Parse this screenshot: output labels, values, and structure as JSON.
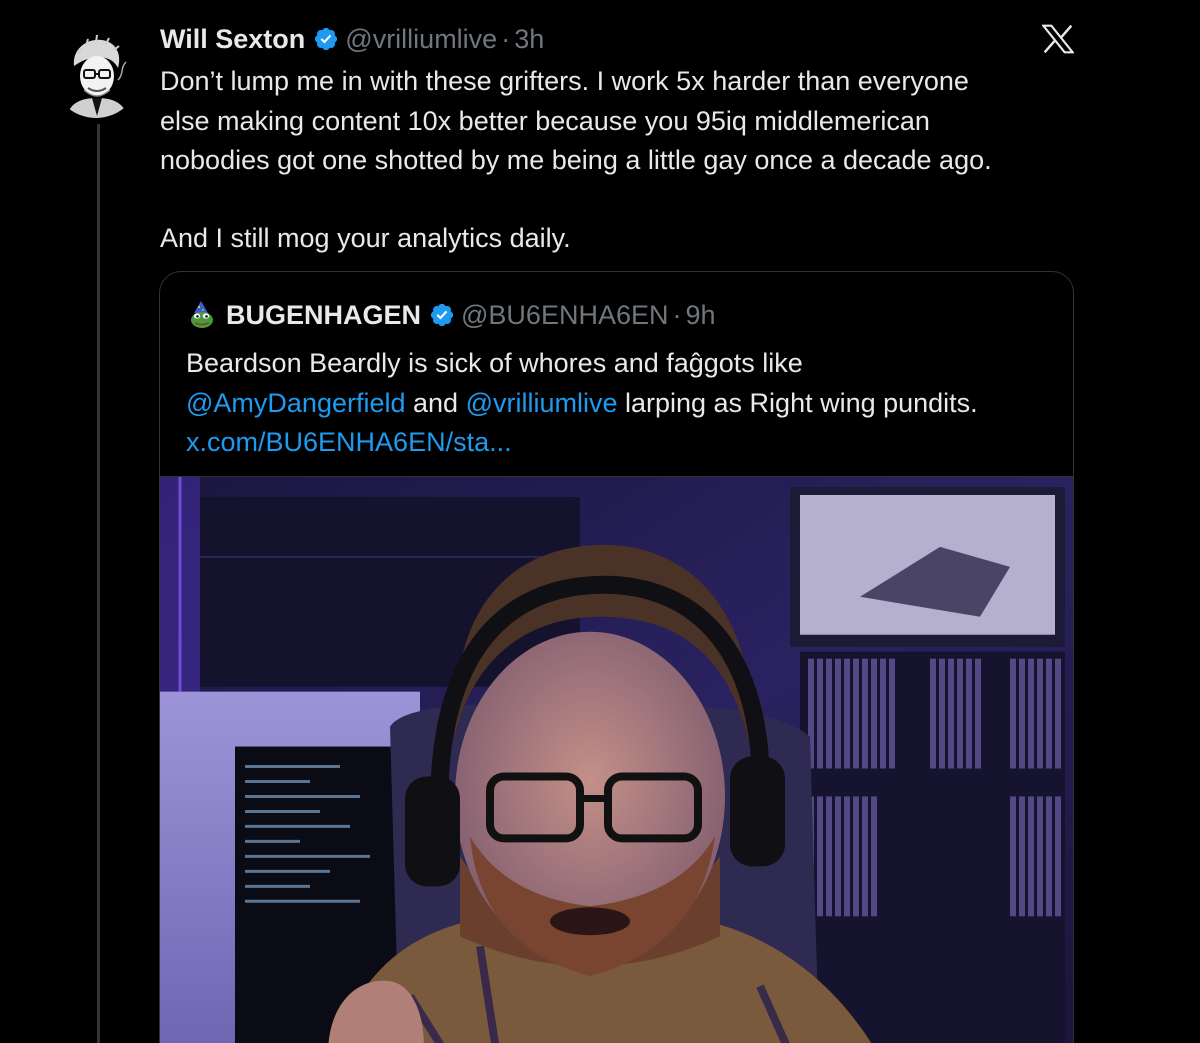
{
  "tweet": {
    "display_name": "Will Sexton",
    "handle": "@vrilliumlive",
    "separator": "·",
    "time": "3h",
    "body_lines": [
      "Don’t lump me in with these grifters. I work 5x harder than everyone",
      "else making content 10x better because you 95iq middlemerican",
      "nobodies got one shotted by me being a little gay once a decade ago."
    ],
    "body_last": "And I still mog your analytics daily."
  },
  "quote": {
    "display_name": "BUGENHAGEN",
    "handle": "@BU6ENHA6EN",
    "separator": "·",
    "time": "9h",
    "line1": "Beardson Beardly is sick of whores and faĝgots like",
    "mention1": "@AmyDangerfield",
    "and_text": " and ",
    "mention2": "@vrilliumlive",
    "line2_rest": " larping as Right wing pundits.",
    "link": "x.com/BU6ENHA6EN/sta..."
  },
  "colors": {
    "background": "#000000",
    "text": "#e7e9ea",
    "muted": "#71767b",
    "link": "#1d9bf0",
    "verified": "#1d9bf0",
    "border": "#2f3336"
  },
  "icons": {
    "verified": "verified-badge-icon",
    "platform": "x-logo-icon"
  }
}
